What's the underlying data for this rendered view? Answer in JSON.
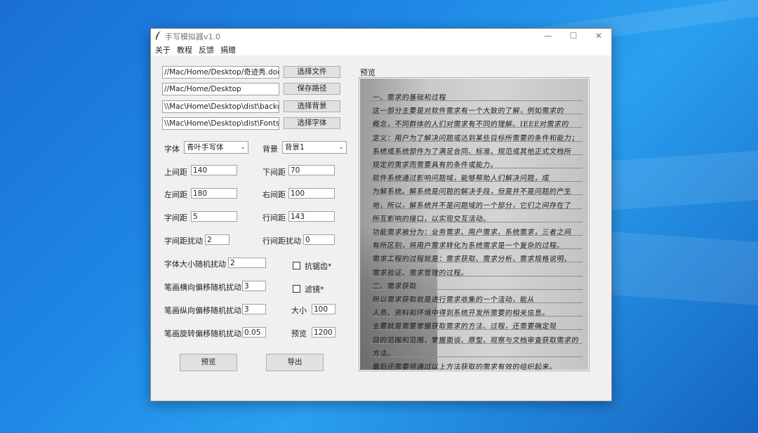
{
  "window": {
    "title": "手写模拟器v1.0"
  },
  "menu": [
    "关于",
    "教程",
    "反馈",
    "捐赠"
  ],
  "paths": {
    "text_file": "//Mac/Home/Desktop/奇迹秀.docx",
    "save_path": "//Mac/Home/Desktop",
    "background": "\\\\Mac\\Home\\Desktop\\dist\\backgrounds",
    "font": "\\\\Mac\\Home\\Desktop\\dist\\Fonts\\"
  },
  "buttons": {
    "choose_file": "选择文件",
    "save_path": "保存路径",
    "choose_bg": "选择背景",
    "choose_font": "选择字体",
    "preview": "预览",
    "export": "导出"
  },
  "settings": {
    "font_label": "字体",
    "font_value": "青叶手写体",
    "bg_label": "背景",
    "bg_value": "背景1",
    "top_margin_label": "上间距",
    "top_margin": "140",
    "bottom_margin_label": "下间距",
    "bottom_margin": "70",
    "left_margin_label": "左间距",
    "left_margin": "180",
    "right_margin_label": "右间距",
    "right_margin": "100",
    "char_spacing_label": "字间距",
    "char_spacing": "5",
    "line_spacing_label": "行间距",
    "line_spacing": "143",
    "char_jitter_label": "字间距扰动",
    "char_jitter": "2",
    "line_jitter_label": "行间距扰动",
    "line_jitter": "0",
    "font_size_jitter_label": "字体大小随机扰动",
    "font_size_jitter": "2",
    "antialias_label": "抗锯齿*",
    "h_offset_label": "笔画横向偏移随机扰动",
    "h_offset": "3",
    "filter_label": "滤镜*",
    "v_offset_label": "笔画纵向偏移随机扰动",
    "v_offset": "3",
    "size_label": "大小",
    "size": "100",
    "rot_offset_label": "笔画旋转偏移随机扰动",
    "rot_offset": "0.05",
    "preview_label": "预览",
    "preview_size": "1200"
  },
  "preview": {
    "heading": "预览",
    "lines": [
      "一、需求的基础和过程",
      "    这一部分主要是对软件需求有一个大致的了解，例如需求的",
      "概念，不同群体的人们对需求有不同的理解。IEEE对需求的",
      "定义：用户为了解决问题或达到某些目标所需要的条件和能力；",
      "系统或系统部件为了满足合同、标准、规范或其他正式文档所",
      "规定的需求而需要具有的条件或能力。",
      "    软件系统通过影响问题域，能够帮助人们解决问题，成",
      "为解系统。解系统是问题的解决手段，但是并不是问题的产生",
      "地，所以，解系统并不是问题域的一个部分，它们之间存在了",
      "所互影响的接口，以实现交互活动。",
      "    功能需求被分为：业务需求、用户需求、系统需求，三者之间",
      "有所区别，将用户需求转化为系统需求是一个复杂的过程。",
      "需求工程的过程就是：需求获取、需求分析、需求规格说明、",
      "需求验证、需求管理的过程。",
      "二、需求获取",
      "    所以需求获取就是进行需求收集的一个活动，能从",
      "人员、资料和环境中得到系统开发所需要的相关信息。",
      "    主要就是需要掌握获取需求的方法、过程，还需要确定现",
      "目的范围和范围，掌握面谈、原型、观察与文档审查获取需求的",
      "方法。",
      "最后还需要将通过以上方法获取的需求有效的组织起来。"
    ]
  }
}
